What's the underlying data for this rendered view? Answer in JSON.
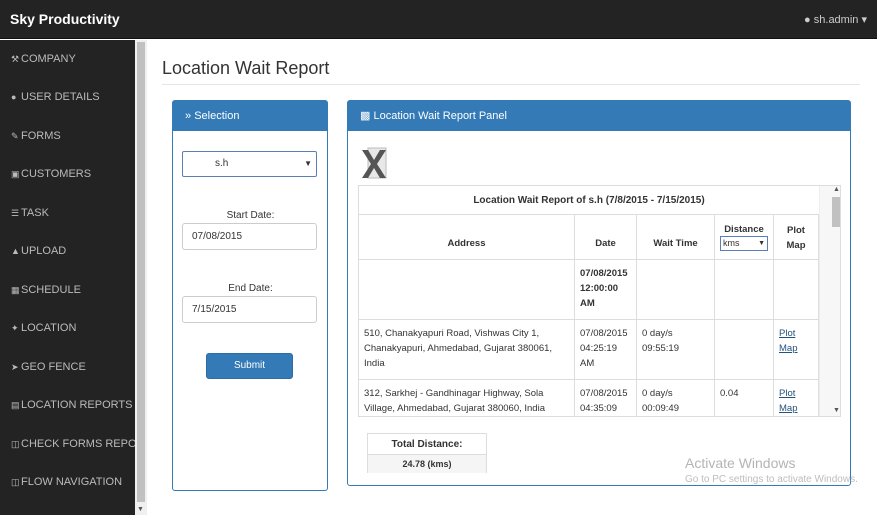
{
  "header": {
    "brand": "Sky Productivity",
    "user": "sh.admin"
  },
  "sidebar": {
    "items": [
      {
        "label": "COMPANY",
        "icon": "wrench-icon"
      },
      {
        "label": "USER DETAILS",
        "icon": "user-icon"
      },
      {
        "label": "FORMS",
        "icon": "edit-icon"
      },
      {
        "label": "CUSTOMERS",
        "icon": "briefcase-icon"
      },
      {
        "label": "TASK",
        "icon": "list-icon"
      },
      {
        "label": "UPLOAD",
        "icon": "upload-icon"
      },
      {
        "label": "SCHEDULE",
        "icon": "calendar-icon"
      },
      {
        "label": "LOCATION",
        "icon": "pushpin-icon"
      },
      {
        "label": "GEO FENCE",
        "icon": "send-icon"
      },
      {
        "label": "LOCATION REPORTS",
        "icon": "file-icon"
      },
      {
        "label": "CHECK FORMS REPORTS",
        "icon": "copy-icon"
      },
      {
        "label": "FLOW NAVIGATION",
        "icon": "copy-icon"
      }
    ]
  },
  "page": {
    "title": "Location Wait Report"
  },
  "selection": {
    "heading": "Selection",
    "user_value": "s.h",
    "start_label": "Start Date:",
    "start_value": "07/08/2015",
    "end_label": "End Date:",
    "end_value": "7/15/2015",
    "submit_label": "Submit"
  },
  "report": {
    "heading": "Location Wait Report Panel",
    "table_title": "Location Wait Report of s.h (7/8/2015 - 7/15/2015)",
    "columns": {
      "address": "Address",
      "date": "Date",
      "wait": "Wait Time",
      "distance": "Distance",
      "distance_unit": "kms",
      "plot": "Plot Map"
    },
    "rows": [
      {
        "address": "",
        "date": "07/08/2015 12:00:00 AM",
        "wait": "",
        "distance": "",
        "plot": ""
      },
      {
        "address": "510, Chanakyapuri Road, Vishwas City 1, Chanakyapuri, Ahmedabad, Gujarat 380061, India",
        "date": "07/08/2015 04:25:19 AM",
        "wait": "0 day/s 09:55:19",
        "distance": "",
        "plot": "Plot Map"
      },
      {
        "address": "312, Sarkhej - Gandhinagar Highway, Sola Village, Ahmedabad, Gujarat 380060, India",
        "date": "07/08/2015 04:35:09",
        "wait": "0 day/s 00:09:49",
        "distance": "0.04",
        "plot": "Plot Map"
      }
    ],
    "total_label": "Total Distance:",
    "total_value": "24.78 (kms)"
  },
  "watermark": {
    "line1": "Activate Windows",
    "line2": "Go to PC settings to activate Windows."
  },
  "colors": {
    "accent": "#337ab7",
    "topbar": "#232323"
  }
}
